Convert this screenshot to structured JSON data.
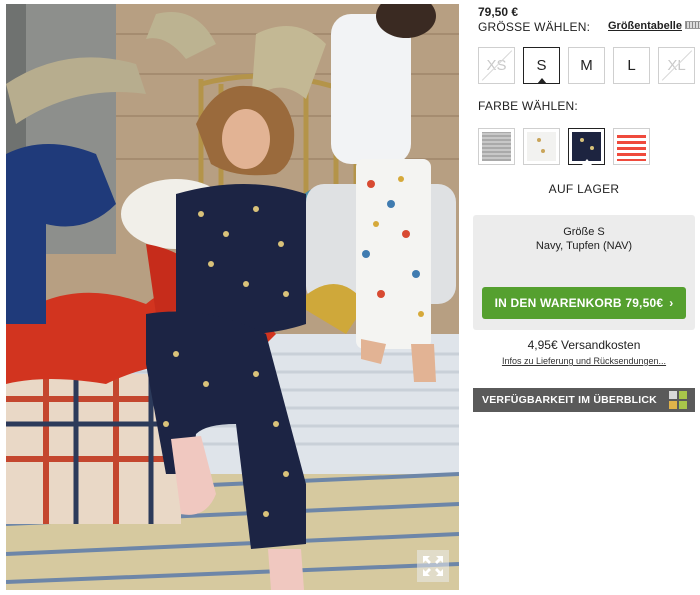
{
  "product": {
    "price": "79,50 €"
  },
  "size_section": {
    "heading": "GRÖSSE WÄHLEN:",
    "size_table_link": "Größentabelle",
    "sizes": [
      {
        "label": "XS",
        "state": "disabled"
      },
      {
        "label": "S",
        "state": "selected"
      },
      {
        "label": "M",
        "state": "available"
      },
      {
        "label": "L",
        "state": "available"
      },
      {
        "label": "XL",
        "state": "disabled"
      }
    ]
  },
  "color_section": {
    "heading": "FARBE WÄHLEN:",
    "swatches": [
      {
        "name": "grey-stripe-swatch",
        "color": "#b4b4b4"
      },
      {
        "name": "white-dot-swatch",
        "color": "#f2f2f0"
      },
      {
        "name": "navy-dot-swatch",
        "color": "#1d2440",
        "selected": true
      },
      {
        "name": "red-stripe-swatch",
        "color": "#ef4a3c"
      }
    ]
  },
  "stock_status": "AUF LAGER",
  "summary": {
    "size_line": "Größe S",
    "color_line": "Navy, Tupfen (NAV)",
    "cart_button": "IN DEN WARENKORB 79,50€"
  },
  "shipping": {
    "cost": "4,95€ Versandkosten",
    "info_link": "Infos zu Lieferung und Rücksendungen..."
  },
  "availability_button": "VERFÜGBARKEIT IM ÜBERBLICK",
  "colors": {
    "cart_green": "#55a02f",
    "dark_button": "#5a5a5a",
    "summary_bg": "#ececec"
  },
  "icons": {
    "expand": "expand-arrows-icon",
    "availability": "color-grid-icon"
  }
}
